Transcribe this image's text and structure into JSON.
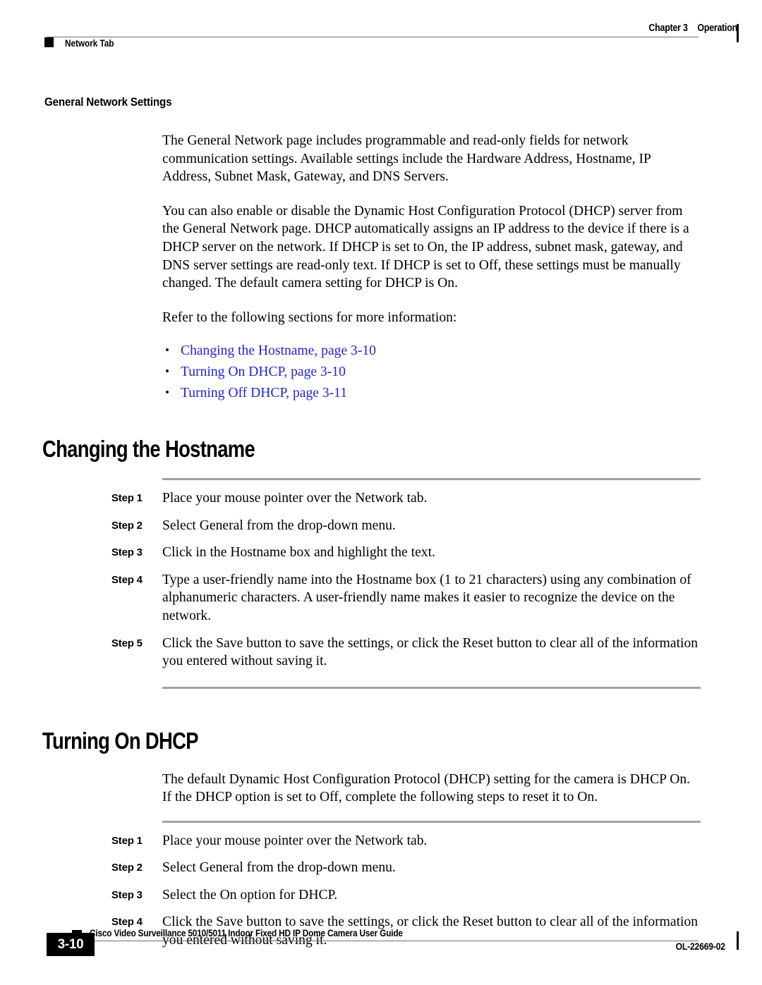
{
  "header": {
    "chapter": "Chapter 3",
    "chapter_section": "Operation",
    "running_head": "Network Tab"
  },
  "content": {
    "sub_heading": "General Network Settings",
    "paragraph_1": "The General Network page includes programmable and read-only fields for network communication settings. Available settings include the Hardware Address, Hostname, IP Address, Subnet Mask, Gateway, and DNS Servers.",
    "paragraph_2": "You can also enable or disable the Dynamic Host Configuration Protocol (DHCP) server from the General Network page. DHCP automatically assigns an IP address to the device if there is a DHCP server on the network. If DHCP is set to On, the IP address, subnet mask, gateway, and DNS server settings are read-only text. If DHCP is set to Off, these settings must be manually changed. The default camera setting for DHCP is On.",
    "paragraph_3": "Refer to the following sections for more information:",
    "cross_references": [
      "Changing the Hostname, page 3-10",
      "Turning On DHCP, page 3-10",
      "Turning Off DHCP, page 3-11"
    ],
    "link_color": "#2323d8"
  },
  "sections": [
    {
      "title": "Changing the Hostname",
      "intro": "",
      "steps": [
        {
          "label": "Step 1",
          "text": "Place your mouse pointer over the Network tab."
        },
        {
          "label": "Step 2",
          "text": "Select General from the drop-down menu."
        },
        {
          "label": "Step 3",
          "text": "Click in the Hostname box and highlight the text."
        },
        {
          "label": "Step 4",
          "text": "Type a user-friendly name into the Hostname box (1 to 21 characters) using any combination of alphanumeric characters. A user-friendly name makes it easier to recognize the device on the network."
        },
        {
          "label": "Step 5",
          "text": "Click the Save button to save the settings, or click the Reset button to clear all of the information you entered without saving it."
        }
      ]
    },
    {
      "title": "Turning On DHCP",
      "intro": "The default Dynamic Host Configuration Protocol (DHCP) setting for the camera is DHCP On. If the DHCP option is set to Off, complete the following steps to reset it to On.",
      "steps": [
        {
          "label": "Step 1",
          "text": "Place your mouse pointer over the Network tab."
        },
        {
          "label": "Step 2",
          "text": "Select General from the drop-down menu."
        },
        {
          "label": "Step 3",
          "text": "Select the On option for DHCP."
        },
        {
          "label": "Step 4",
          "text": "Click the Save button to save the settings, or click the Reset button to clear all of the information you entered without saving it."
        }
      ]
    }
  ],
  "footer": {
    "page_number": "3-10",
    "guide_title": "Cisco Video Surveillance 5010/5011 Indoor Fixed HD IP Dome Camera User Guide",
    "document_id": "OL-22669-02"
  }
}
